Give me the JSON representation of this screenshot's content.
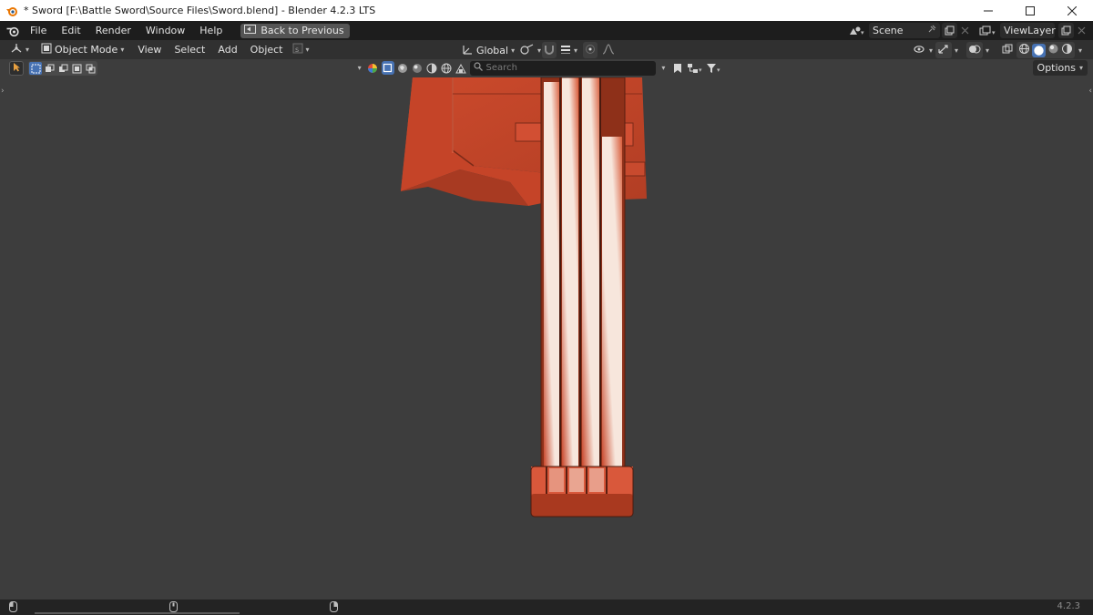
{
  "window": {
    "title": "* Sword [F:\\Battle Sword\\Source Files\\Sword.blend] - Blender 4.2.3 LTS",
    "controls": [
      "minimize-icon",
      "maximize-icon",
      "close-icon"
    ]
  },
  "menubar": {
    "items": [
      "File",
      "Edit",
      "Render",
      "Window",
      "Help"
    ],
    "back_label": "Back to Previous",
    "scene_name": "Scene",
    "view_layer": "ViewLayer"
  },
  "viewport_header": {
    "mode": "Object Mode",
    "menus": [
      "View",
      "Select",
      "Add",
      "Object"
    ],
    "orientation": "Global"
  },
  "overlays": {
    "search_placeholder": "Search",
    "options_label": "Options"
  },
  "statusbar": {
    "version": "4.2.3"
  },
  "colors": {
    "viewport_bg": "#3d3d3d",
    "sword_base": "#c8462a",
    "sword_highlight": "#f9ece4",
    "accent_blue": "#4772b3"
  }
}
